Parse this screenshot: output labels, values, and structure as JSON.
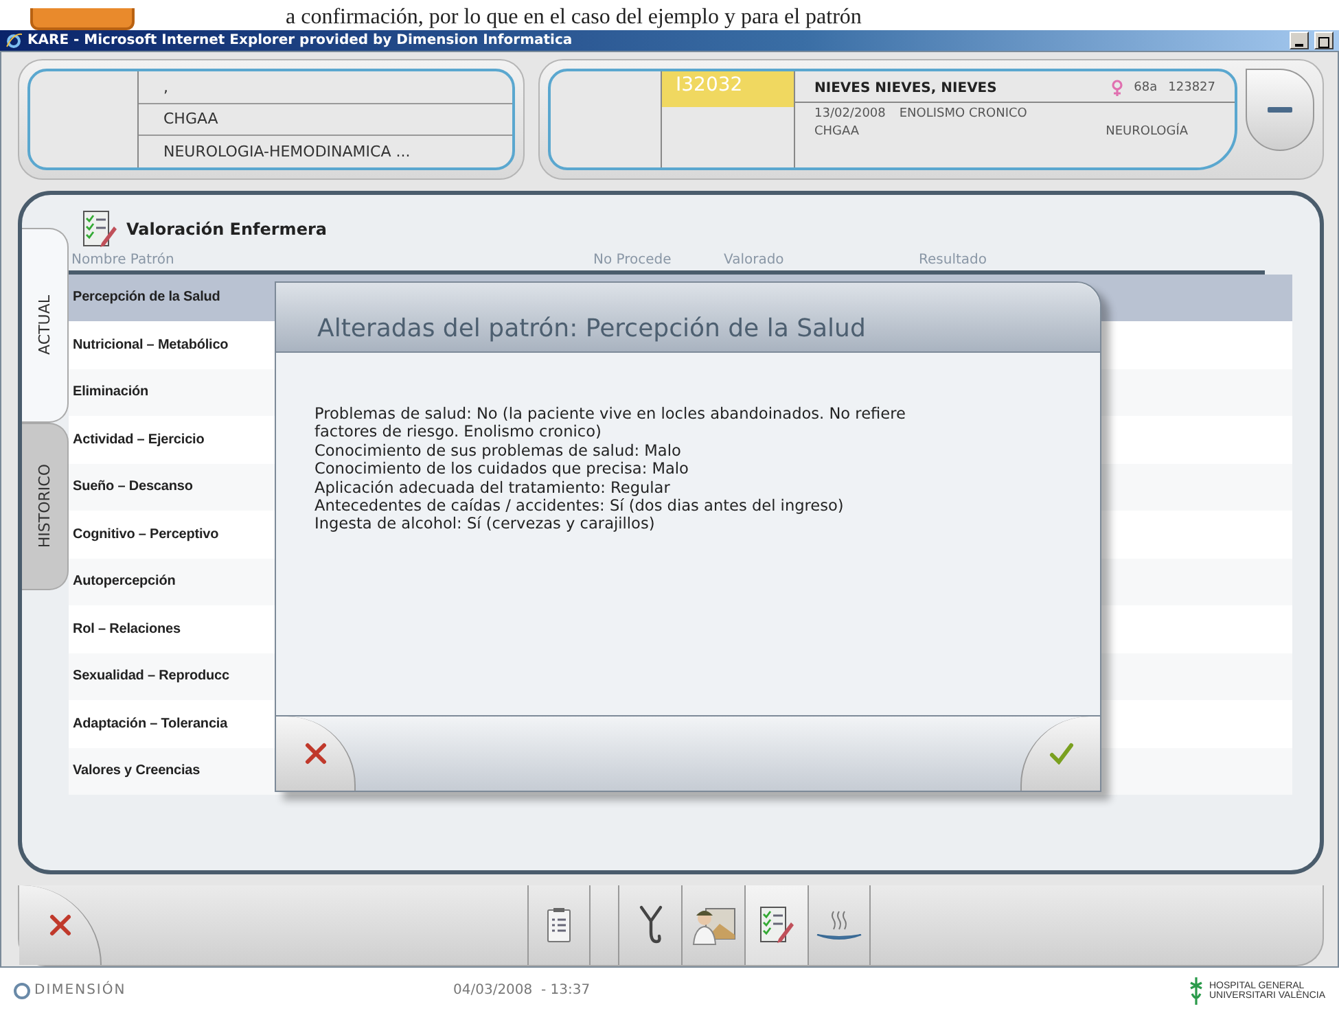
{
  "document_text": "a confirmación, por lo que en el caso del ejemplo y para el patrón",
  "window": {
    "title": "KARE - Microsoft Internet Explorer provided by Dimension Informatica"
  },
  "context": {
    "lines": [
      ",",
      "CHGAA",
      "NEUROLOGIA-HEMODINAMICA ..."
    ]
  },
  "patient": {
    "episode": "I32032",
    "name": "NIEVES NIEVES, NIEVES",
    "age": "68a",
    "record": "123827",
    "date": "13/02/2008",
    "diagnosis": "ENOLISMO CRONICO",
    "center": "CHGAA",
    "service": "NEUROLOGÍA"
  },
  "side_tabs": [
    {
      "label": "ACTUAL",
      "selected": true
    },
    {
      "label": "HISTORICO",
      "selected": false
    }
  ],
  "assessment": {
    "title": "Valoración Enfermera",
    "columns": [
      "Nombre Patrón",
      "No Procede",
      "Valorado",
      "Resultado"
    ],
    "rows": [
      {
        "name": "Percepción de la Salud",
        "selected": true
      },
      {
        "name": "Nutricional – Metabólico",
        "selected": false
      },
      {
        "name": "Eliminación",
        "selected": false
      },
      {
        "name": "Actividad – Ejercicio",
        "selected": false
      },
      {
        "name": "Sueño – Descanso",
        "selected": false
      },
      {
        "name": "Cognitivo – Perceptivo",
        "selected": false
      },
      {
        "name": "Autopercepción",
        "selected": false
      },
      {
        "name": "Rol – Relaciones",
        "selected": false
      },
      {
        "name": "Sexualidad – Reproducc",
        "selected": false
      },
      {
        "name": "Adaptación – Tolerancia",
        "selected": false
      },
      {
        "name": "Valores y Creencias",
        "selected": false
      }
    ]
  },
  "dialog": {
    "title": "Alteradas del patrón: Percepción de la Salud",
    "lines": [
      "Problemas de salud: No (la paciente vive en locles abandoinados. No refiere factores de riesgo. Enolismo cronico)",
      "Conocimiento de sus problemas de salud: Malo",
      "Conocimiento de los cuidados que precisa: Malo",
      "Aplicación adecuada del tratamiento: Regular",
      "Antecedentes de caídas / accidentes: Sí (dos dias antes del ingreso)",
      "Ingesta de alcohol: Sí (cervezas y carajillos)"
    ]
  },
  "toolbar": [
    {
      "kind": "clipboard",
      "selected": false
    },
    {
      "kind": "stethoscope",
      "selected": false
    },
    {
      "kind": "nurse",
      "selected": false
    },
    {
      "kind": "checklist",
      "selected": true
    },
    {
      "kind": "plate",
      "selected": false
    }
  ],
  "footer": {
    "brand": "DIMENSIÓN",
    "datetime": "04/03/2008  - 13:37",
    "hospital": [
      "HOSPITAL GENERAL",
      "UNIVERSITARI VALÈNCIA"
    ]
  }
}
